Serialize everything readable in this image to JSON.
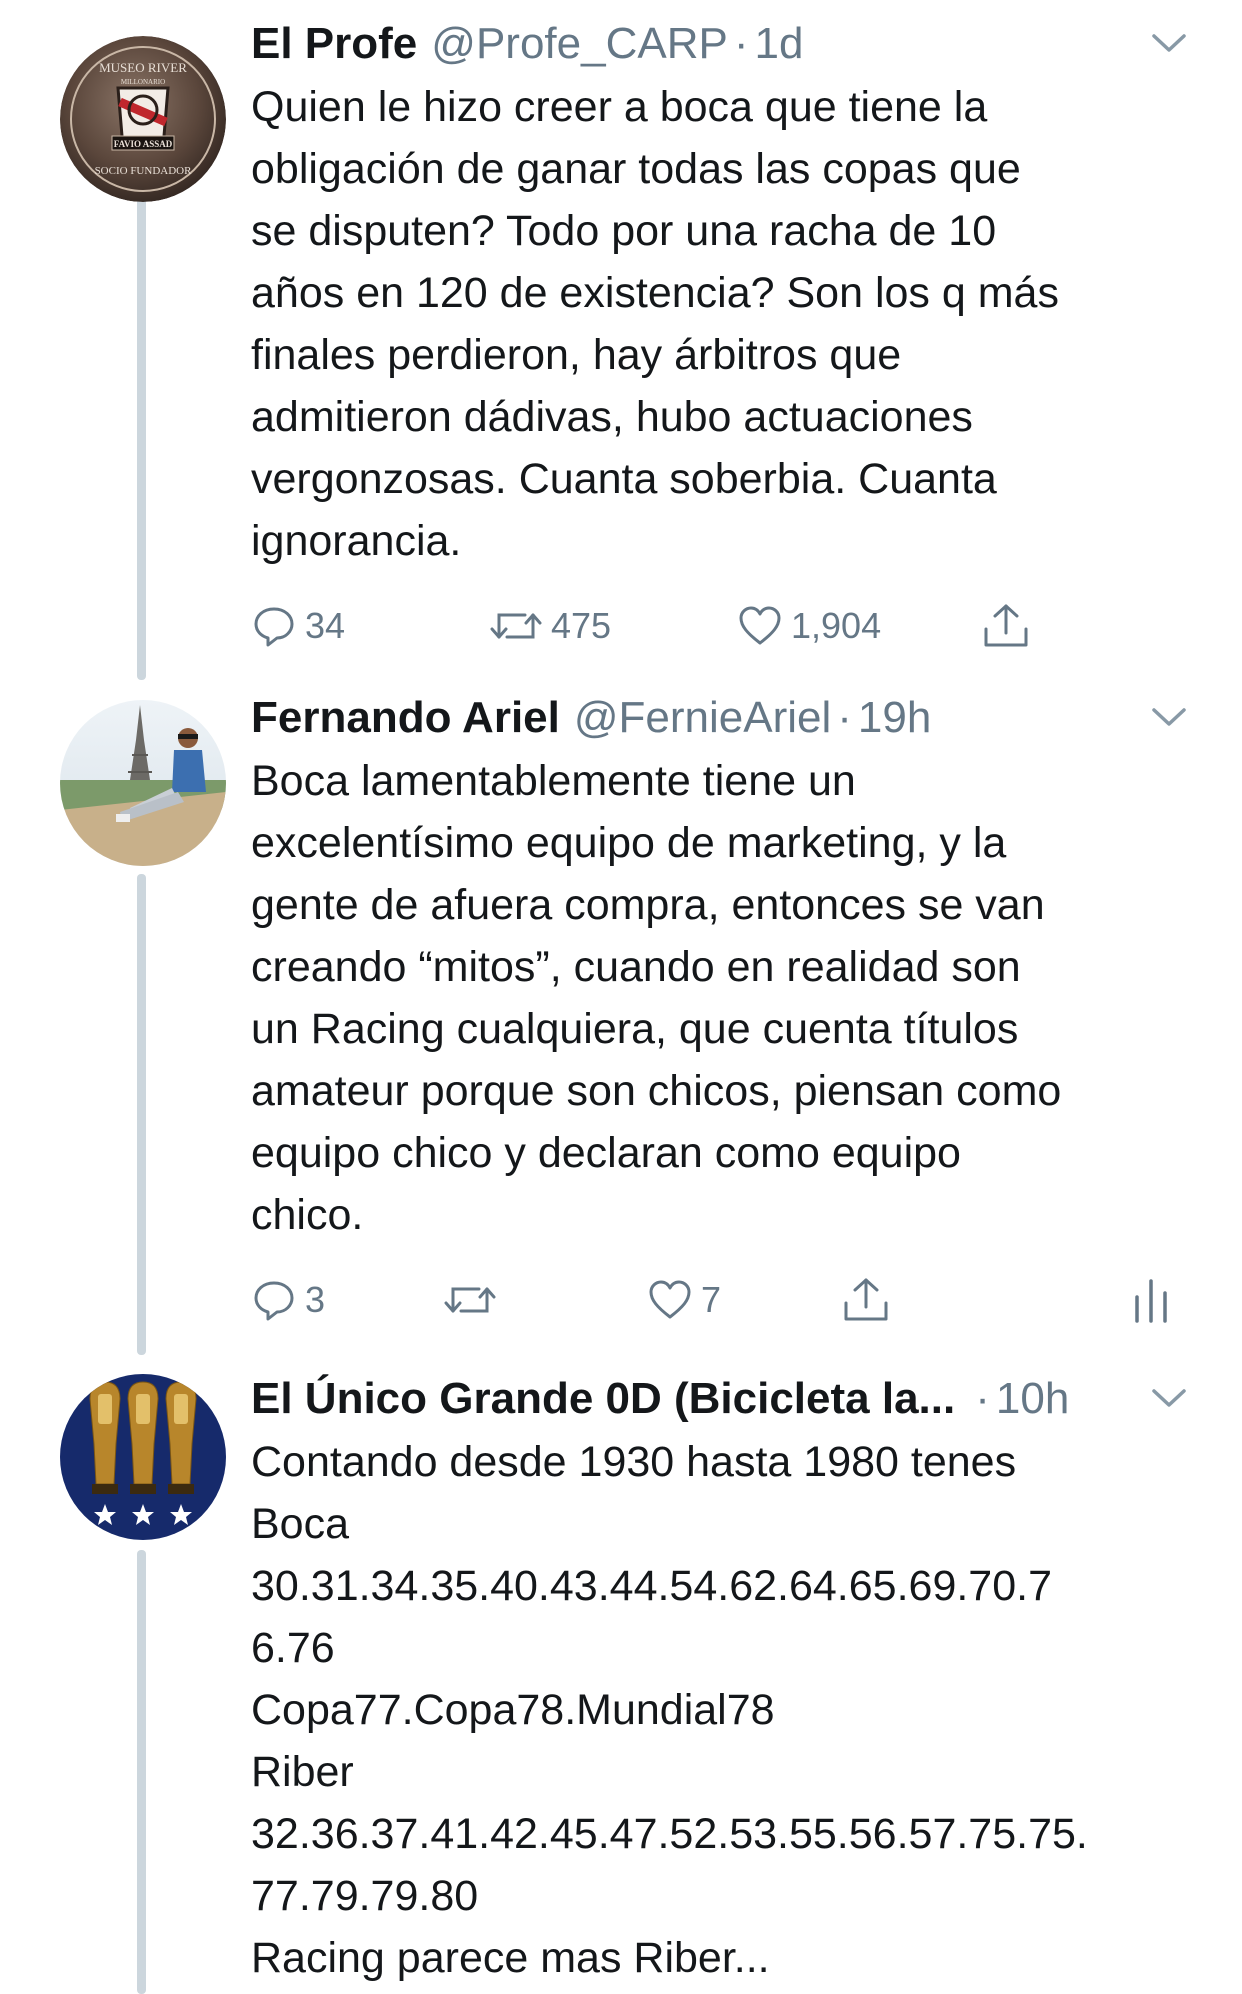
{
  "tweets": [
    {
      "name": "El Profe",
      "handle": "@Profe_CARP",
      "separator": "·",
      "time": "1d",
      "text": "Quien le hizo creer a boca que tiene la\nobligación de ganar todas las copas que\nse disputen? Todo por una racha de 10\naños en 120 de existencia? Son los q más\nfinales perdieron, hay árbitros que\nadmitieron dádivas, hubo actuaciones\nvergonzosas. Cuanta soberbia. Cuanta\nignorancia.",
      "replies": "34",
      "retweets": "475",
      "likes": "1,904",
      "avatar": {
        "badge_top": "MUSEO RIVER",
        "badge_sub": "MILLONARIO",
        "badge_name": "FAVIO ASSAD",
        "badge_bottom": "SOCIO FUNDADOR"
      }
    },
    {
      "name": "Fernando Ariel",
      "handle": "@FernieAriel",
      "separator": "·",
      "time": "19h",
      "text": "Boca lamentablemente tiene un\nexcelentísimo equipo de marketing, y la\ngente de afuera compra, entonces se van\ncreando “mitos”, cuando en realidad son\nun Racing cualquiera, que cuenta títulos\namateur porque son chicos, piensan como\nequipo chico y declaran como equipo\nchico.",
      "replies": "3",
      "retweets": "",
      "likes": "7"
    },
    {
      "name": "El Único Grande 0D (Bicicleta la...",
      "handle": "",
      "separator": "·",
      "time": "10h",
      "text": "Contando desde 1930 hasta 1980 tenes\nBoca\n30.31.34.35.40.43.44.54.62.64.65.69.70.7\n6.76\nCopa77.Copa78.Mundial78\nRiber\n32.36.37.41.42.45.47.52.53.55.56.57.75.75.\n77.79.79.80\nRacing parece mas Riber..."
    }
  ],
  "icons": {
    "reply": "reply-icon",
    "retweet": "retweet-icon",
    "like": "heart-icon",
    "share": "share-icon",
    "analytics": "analytics-icon",
    "caret": "chevron-down-icon"
  },
  "colors": {
    "text": "#14171a",
    "secondary": "#657786",
    "thread_line": "#ccd6dd",
    "icon": "#657786"
  }
}
